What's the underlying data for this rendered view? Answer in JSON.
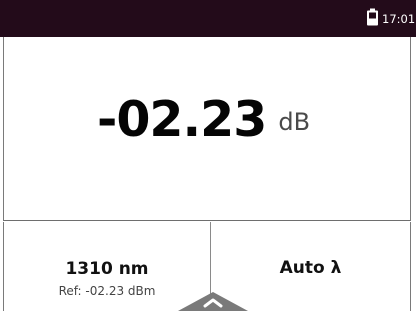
{
  "status_bar": {
    "icon": "battery-icon",
    "time": "17:01",
    "background": "#230b1a"
  },
  "measurement": {
    "value": "-02.23",
    "unit": "dB"
  },
  "buttons": {
    "wavelength": {
      "label": "1310 nm",
      "reference": "Ref: -02.23 dBm"
    },
    "auto": {
      "label": "Auto λ"
    }
  },
  "indicator": {
    "icon": "chevron-up-icon",
    "color": "#777777"
  }
}
